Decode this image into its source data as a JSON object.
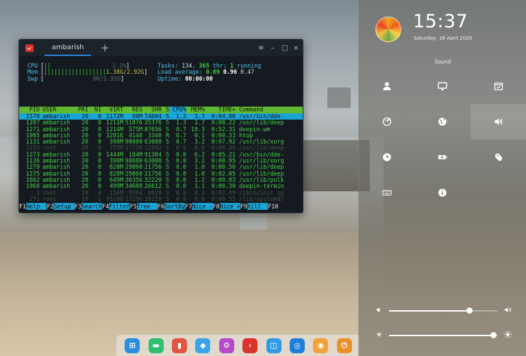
{
  "terminal": {
    "tab_title": "ambarish",
    "add_tab": "+",
    "controls": [
      "≡",
      "–",
      "□",
      "×"
    ]
  },
  "htop": {
    "meters": {
      "cpu_label": "CPU",
      "cpu_bar": "||",
      "cpu_value": "1.3%",
      "mem_label": "Mem",
      "mem_bar": "||||||||||||||||||",
      "mem_value": "1.38G/2.92G",
      "swp_label": "Swp",
      "swp_value": "0K/1.95G"
    },
    "summary": {
      "tasks_label": "Tasks: ",
      "tasks": "134",
      "threads": "365",
      "thr_label": " thr; ",
      "running": "1",
      "running_label": " running",
      "load_label": "Load average: ",
      "load_1": "0.89",
      "load_5": "0.96",
      "load_15": "0.47",
      "uptime_label": "Uptime: ",
      "uptime": "00:06:00"
    },
    "columns": [
      "PID",
      "USER",
      "PRI",
      "NI",
      "VIRT",
      "RES",
      "SHR",
      "S",
      "CPU%",
      "MEM%",
      "TIME+",
      "Command"
    ],
    "rows": [
      {
        "pid": "1570",
        "user": "ambarish",
        "pri": "20",
        "ni": "0",
        "virt": "1172M",
        "res": "98M",
        "shr": "74604",
        "s": "S",
        "cpu": "1.3",
        "mem": "3.3",
        "time": "0:04.80",
        "cmd": "/usr/bin/dde-",
        "style": "sel"
      },
      {
        "pid": "1287",
        "user": "ambarish",
        "pri": "20",
        "ni": "0",
        "virt": "1211M",
        "res": "51876",
        "shr": "35376",
        "s": "S",
        "cpu": "1.3",
        "mem": "1.7",
        "time": "0:00.22",
        "cmd": "/usr/lib/deep",
        "style": ""
      },
      {
        "pid": "1271",
        "user": "ambarish",
        "pri": "20",
        "ni": "0",
        "virt": "1214M",
        "res": "575M",
        "shr": "87656",
        "s": "S",
        "cpu": "0.7",
        "mem": "19.3",
        "time": "0:52.31",
        "cmd": "deepin-wm",
        "style": ""
      },
      {
        "pid": "1985",
        "user": "ambarish",
        "pri": "20",
        "ni": "0",
        "virt": "32816",
        "res": "4140",
        "shr": "3340",
        "s": "R",
        "cpu": "0.7",
        "mem": "0.1",
        "time": "0:00.33",
        "cmd": "htop",
        "style": ""
      },
      {
        "pid": "1131",
        "user": "ambarish",
        "pri": "20",
        "ni": "0",
        "virt": "398M",
        "res": "98080",
        "shr": "63080",
        "s": "S",
        "cpu": "0.7",
        "mem": "3.2",
        "time": "0:07.92",
        "cmd": "/usr/lib/xorg",
        "style": ""
      },
      {
        "pid": "1253",
        "user": "root",
        "pri": "20",
        "ni": "0",
        "virt": "755M",
        "res": "17728",
        "shr": "12992",
        "s": "S",
        "cpu": "0.0",
        "mem": "0.6",
        "time": "0:00.48",
        "cmd": "/usr/lib/deep",
        "style": "root"
      },
      {
        "pid": "1273",
        "user": "ambarish",
        "pri": "20",
        "ni": "0",
        "virt": "1444M",
        "res": "184M",
        "shr": "91384",
        "s": "S",
        "cpu": "0.0",
        "mem": "6.2",
        "time": "0:05.21",
        "cmd": "/usr/bin/dde-",
        "style": ""
      },
      {
        "pid": "1136",
        "user": "ambarish",
        "pri": "20",
        "ni": "0",
        "virt": "398M",
        "res": "98080",
        "shr": "63088",
        "s": "S",
        "cpu": "0.0",
        "mem": "3.2",
        "time": "0:00.95",
        "cmd": "/usr/lib/xorg",
        "style": ""
      },
      {
        "pid": "1279",
        "user": "ambarish",
        "pri": "20",
        "ni": "0",
        "virt": "828M",
        "res": "29860",
        "shr": "21756",
        "s": "S",
        "cpu": "0.0",
        "mem": "1.0",
        "time": "0:00.56",
        "cmd": "/usr/lib/deep",
        "style": ""
      },
      {
        "pid": "1275",
        "user": "ambarish",
        "pri": "20",
        "ni": "0",
        "virt": "828M",
        "res": "29860",
        "shr": "21756",
        "s": "S",
        "cpu": "0.0",
        "mem": "1.0",
        "time": "0:02.05",
        "cmd": "/usr/lib/deep",
        "style": ""
      },
      {
        "pid": "1662",
        "user": "ambarish",
        "pri": "20",
        "ni": "0",
        "virt": "649M",
        "res": "36356",
        "shr": "32220",
        "s": "S",
        "cpu": "0.0",
        "mem": "1.2",
        "time": "0:00.03",
        "cmd": "/usr/lib/polk",
        "style": ""
      },
      {
        "pid": "1968",
        "user": "ambarish",
        "pri": "20",
        "ni": "0",
        "virt": "499M",
        "res": "34688",
        "shr": "26612",
        "s": "S",
        "cpu": "0.0",
        "mem": "1.1",
        "time": "0:00.30",
        "cmd": "deepin-termin",
        "style": ""
      },
      {
        "pid": "1",
        "user": "root",
        "pri": "20",
        "ni": "0",
        "virt": "156M",
        "res": "9304",
        "shr": "6828",
        "s": "S",
        "cpu": "0.0",
        "mem": "0.3",
        "time": "0:02.09",
        "cmd": "/sbin/init sp",
        "style": "root"
      },
      {
        "pid": "271",
        "user": "root",
        "pri": "19",
        "ni": "-1",
        "virt": "95108",
        "res": "17196",
        "shr": "16220",
        "s": "S",
        "cpu": "0.0",
        "mem": "0.6",
        "time": "0:00.55",
        "cmd": "/lib/systemd/",
        "style": "root"
      }
    ],
    "fkeys": [
      {
        "key": "F1",
        "label": "Help  "
      },
      {
        "key": "F2",
        "label": "Setup "
      },
      {
        "key": "F3",
        "label": "Search"
      },
      {
        "key": "F4",
        "label": "Filter"
      },
      {
        "key": "F5",
        "label": "Tree  "
      },
      {
        "key": "F6",
        "label": "SortBy"
      },
      {
        "key": "F7",
        "label": "Nice -"
      },
      {
        "key": "F8",
        "label": "Nice +"
      },
      {
        "key": "F9",
        "label": "Kill  "
      },
      {
        "key": "F10",
        "label": ""
      }
    ]
  },
  "dock": {
    "items": [
      {
        "name": "launcher",
        "glyph": "⊞",
        "color": "#2b8fe0"
      },
      {
        "name": "file-manager",
        "glyph": "▬",
        "color": "#2fbf6e"
      },
      {
        "name": "video",
        "glyph": "▮",
        "color": "#e0563f"
      },
      {
        "name": "app-store",
        "glyph": "◆",
        "color": "#3aa5e8"
      },
      {
        "name": "settings",
        "glyph": "⚙",
        "color": "#b64ac9"
      },
      {
        "name": "terminal",
        "glyph": "›",
        "color": "#d9342b"
      },
      {
        "name": "system-monitor",
        "glyph": "◫",
        "color": "#2f9be6"
      },
      {
        "name": "screen-recorder",
        "glyph": "◎",
        "color": "#1f7fd8"
      },
      {
        "name": "browser",
        "glyph": "◉",
        "color": "#f0a33a"
      },
      {
        "name": "power",
        "glyph": "⏻",
        "color": "#e8912b"
      }
    ]
  },
  "control_center": {
    "time": "15:37",
    "date": "Saturday, 18 April 2020",
    "section_label": "Sound",
    "tiles": [
      {
        "name": "accounts",
        "icon": "person",
        "active": false
      },
      {
        "name": "display",
        "icon": "monitor",
        "active": false
      },
      {
        "name": "default-applications",
        "icon": "calendar-check",
        "active": false
      },
      {
        "name": "personalization",
        "icon": "palette",
        "active": false
      },
      {
        "name": "network",
        "icon": "globe",
        "active": false
      },
      {
        "name": "sound",
        "icon": "speaker",
        "active": true
      },
      {
        "name": "date-and-time",
        "icon": "clock",
        "active": false
      },
      {
        "name": "power",
        "icon": "battery",
        "active": false
      },
      {
        "name": "mouse",
        "icon": "mouse",
        "active": false
      },
      {
        "name": "keyboard",
        "icon": "keyboard",
        "active": false
      },
      {
        "name": "system-info",
        "icon": "info",
        "active": false
      },
      {
        "name": "empty",
        "icon": "",
        "active": false
      }
    ],
    "volume_level": 0.74,
    "brightness_level": 0.96
  }
}
